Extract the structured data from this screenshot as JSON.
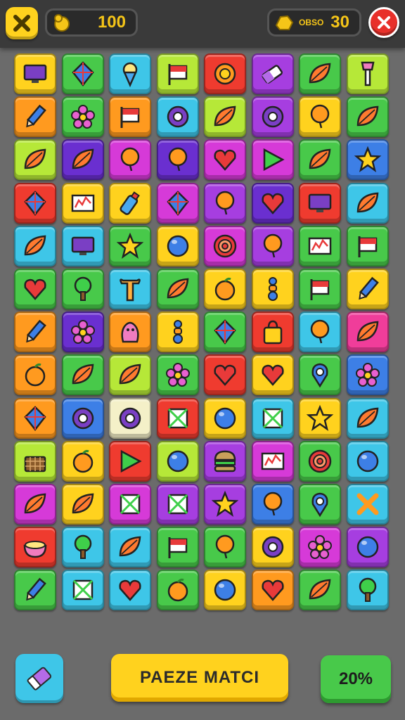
{
  "top_bar": {
    "coins_value": "100",
    "gems_label": "OBSO",
    "gems_value": "30"
  },
  "colors": {
    "yellow": "#ffd21e",
    "green": "#48c94a",
    "cyan": "#3ec6e8",
    "purple": "#a63ee0",
    "orange": "#ff9a1f",
    "lime": "#b6e838",
    "red": "#ef3b2f",
    "magenta": "#d63ad8",
    "blue": "#3d7fe6",
    "violet": "#6a2fd0",
    "pink": "#f03d9a",
    "cream": "#f4f0c8"
  },
  "board": {
    "rows": [
      [
        "yellow:monitor",
        "green:kite",
        "cyan:icecream",
        "lime:flag",
        "red:sun",
        "purple:battery",
        "green:leaf",
        "lime:brush"
      ],
      [
        "orange:pen",
        "green:flower",
        "orange:flag",
        "cyan:ring",
        "lime:leaf",
        "purple:ring",
        "yellow:balloon",
        "green:leaf"
      ],
      [
        "lime:leaf",
        "violet:leaf",
        "magenta:balloon",
        "violet:balloon",
        "magenta:heart",
        "magenta:play",
        "green:leaf",
        "blue:star"
      ],
      [
        "red:kite",
        "yellow:chart",
        "yellow:bottle",
        "magenta:kite",
        "purple:balloon",
        "violet:heart",
        "red:monitor",
        "cyan:leaf"
      ],
      [
        "cyan:leaf",
        "cyan:monitor",
        "green:star",
        "yellow:ball",
        "magenta:target",
        "purple:balloon",
        "green:chart",
        "green:flag"
      ],
      [
        "green:heart",
        "green:tree",
        "cyan:bone",
        "green:leaf",
        "yellow:fruit",
        "yellow:figure",
        "green:flag",
        "yellow:pen"
      ],
      [
        "orange:pen",
        "violet:flower",
        "orange:creature",
        "yellow:figure",
        "green:kite",
        "red:bag",
        "cyan:balloon",
        "pink:leaf"
      ],
      [
        "orange:fruit",
        "green:leaf",
        "lime:leaf",
        "green:flower",
        "red:heart",
        "yellow:heart",
        "green:pin",
        "blue:flower"
      ],
      [
        "orange:kite",
        "blue:ring",
        "cream:ring",
        "red:box",
        "yellow:ball",
        "cyan:box",
        "yellow:star",
        "cyan:leaf"
      ],
      [
        "lime:basket",
        "yellow:fruit",
        "red:play",
        "lime:ball",
        "purple:burger",
        "magenta:chart",
        "green:target",
        "cyan:ball"
      ],
      [
        "magenta:leaf",
        "yellow:leaf",
        "magenta:box",
        "purple:box",
        "purple:star",
        "blue:balloon",
        "green:pin",
        "cyan:cross"
      ],
      [
        "red:bowl",
        "cyan:tree",
        "cyan:leaf",
        "green:flag",
        "green:balloon",
        "yellow:ring",
        "magenta:flower",
        "purple:ball"
      ],
      [
        "green:pen",
        "cyan:box",
        "cyan:heart",
        "green:fruit",
        "yellow:ball",
        "orange:heart",
        "green:leaf",
        "cyan:tree"
      ]
    ]
  },
  "bottom_bar": {
    "match_label": "PAEZE MATCI",
    "percent_label": "20%"
  }
}
